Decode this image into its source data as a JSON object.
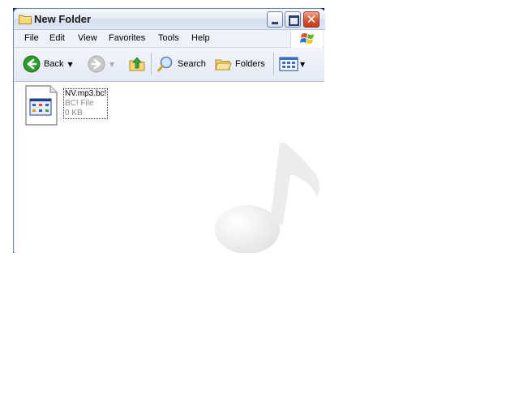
{
  "window": {
    "title": "New Folder"
  },
  "menu": [
    "File",
    "Edit",
    "View",
    "Favorites",
    "Tools",
    "Help"
  ],
  "toolbar": {
    "back_label": "Back",
    "search_label": "Search",
    "folders_label": "Folders"
  },
  "file": {
    "name": "NV.mp3.bc!",
    "type": "BC! File",
    "size": "0 KB"
  },
  "colors": {
    "title_text": "#1a1a1a",
    "close_button": "#d6532f",
    "back_arrow": "#2e9a2e",
    "secondary_text": "#8a8a8a"
  }
}
